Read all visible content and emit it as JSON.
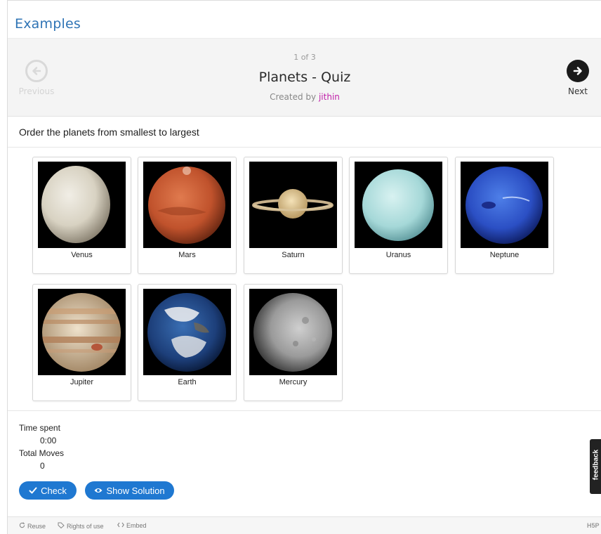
{
  "header": {
    "title": "Examples"
  },
  "navigation": {
    "previous_label": "Previous",
    "next_label": "Next",
    "counter": "1 of 3",
    "quiz_title": "Planets - Quiz",
    "created_by_prefix": "Created by",
    "author": "jithin"
  },
  "question": "Order the planets from smallest to largest",
  "cards": [
    {
      "label": "Venus"
    },
    {
      "label": "Mars"
    },
    {
      "label": "Saturn"
    },
    {
      "label": "Uranus"
    },
    {
      "label": "Neptune"
    },
    {
      "label": "Jupiter"
    },
    {
      "label": "Earth"
    },
    {
      "label": "Mercury"
    }
  ],
  "stats": {
    "time_label": "Time spent",
    "time_value": "0:00",
    "moves_label": "Total Moves",
    "moves_value": "0"
  },
  "buttons": {
    "check_label": "Check",
    "show_solution_label": "Show Solution"
  },
  "feedback_tab": "feedback",
  "footer": {
    "reuse": "Reuse",
    "rights": "Rights of use",
    "embed": "Embed",
    "h5p": "H5P"
  },
  "colors": {
    "brand": "#2f74b5",
    "button": "#1f78d1",
    "author_link": "#c01fa9"
  },
  "icons": {
    "previous": "arrow-left-circle-icon",
    "next": "arrow-right-circle-icon",
    "check": "checkmark-icon",
    "show_solution": "eye-icon",
    "reuse": "refresh-icon",
    "rights": "tag-icon",
    "embed": "code-icon"
  }
}
